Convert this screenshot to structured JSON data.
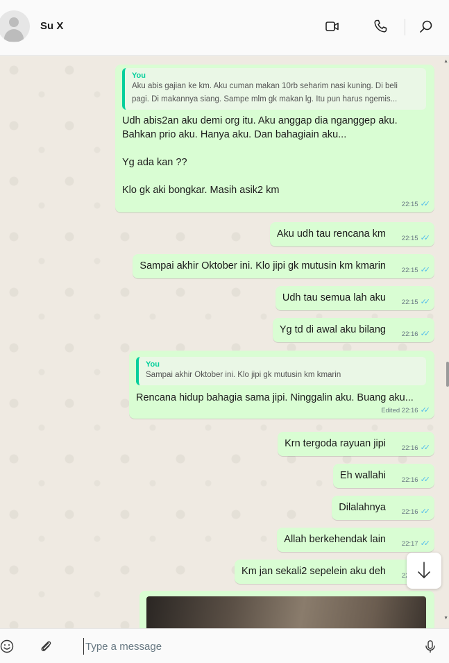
{
  "header": {
    "contact_name": "Su X"
  },
  "messages": [
    {
      "quote_author": "You",
      "quote_lines": [
        "Aku abis gajian ke km. Aku cuman makan 10rb seharim nasi kuning. Di beli",
        "pagi. Di makannya siang. Sampe mlm gk makan lg. Itu pun harus ngemis..."
      ],
      "lines": [
        "Udh abis2an aku demi org itu. Aku anggap dia nganggep aku.",
        "Bahkan prio aku. Hanya aku. Dan bahagiain aku...",
        "",
        "Yg ada kan ??",
        "",
        "Klo gk aki bongkar. Masih asik2 km"
      ],
      "time": "22:15"
    },
    {
      "text": "Aku udh tau rencana km",
      "time": "22:15"
    },
    {
      "text": "Sampai akhir Oktober ini. Klo jipi gk mutusin km kmarin",
      "time": "22:15"
    },
    {
      "text": "Udh tau semua lah aku",
      "time": "22:15"
    },
    {
      "text": "Yg td di awal aku bilang",
      "time": "22:16"
    },
    {
      "quote_author": "You",
      "quote_text": "Sampai akhir Oktober ini. Klo jipi gk mutusin km kmarin",
      "text": "Rencana hidup bahagia sama jipi. Ninggalin aku. Buang aku...",
      "edited_label": "Edited",
      "time": "22:16"
    },
    {
      "text": "Krn tergoda rayuan jipi",
      "time": "22:16"
    },
    {
      "text": "Eh wallahi",
      "time": "22:16"
    },
    {
      "text": "Dilalahnya",
      "time": "22:16"
    },
    {
      "text": "Allah berkehendak lain",
      "time": "22:17"
    },
    {
      "text": "Km jan sekali2 sepelein aku deh",
      "time": "22:17"
    }
  ],
  "composer": {
    "placeholder": "Type a message"
  },
  "icons": {
    "video": "video-call-icon",
    "voice": "phone-icon",
    "search": "search-icon",
    "emoji": "emoji-icon",
    "attach": "paperclip-icon",
    "mic": "microphone-icon",
    "scroll_down": "arrow-down-icon"
  },
  "colors": {
    "outgoing_bubble": "#d9fdd3",
    "quote_accent": "#06cf9c",
    "read_tick": "#53bdeb",
    "chat_background": "#efeae2"
  }
}
